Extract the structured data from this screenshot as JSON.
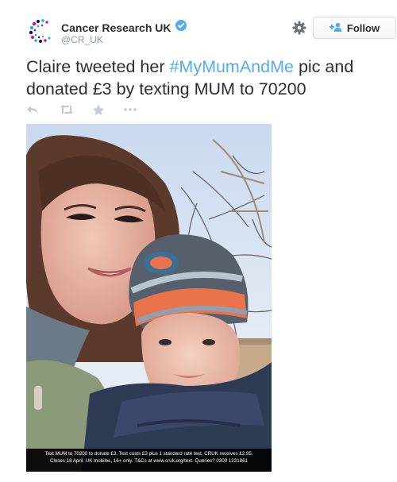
{
  "account": {
    "name": "Cancer Research UK",
    "handle": "@CR_UK",
    "verified": true,
    "brand_colors": [
      "#e6007e",
      "#2e008b",
      "#00b6ed"
    ]
  },
  "header": {
    "settings_icon": "gear-icon",
    "follow_label": "Follow",
    "follow_icon": "add-person-icon"
  },
  "tweet": {
    "text_before": "Claire tweeted her ",
    "hashtag": "#MyMumAndMe",
    "text_after": " pic and donated £3 by texting MUM to 70200",
    "hashtag_color": "#55acee"
  },
  "actions": [
    {
      "icon": "reply-icon"
    },
    {
      "icon": "retweet-icon"
    },
    {
      "icon": "favorite-star-icon"
    },
    {
      "icon": "more-dots-icon"
    }
  ],
  "photo": {
    "caption_line1": "Text MUM to 70200 to donate £3. Text costs £3 plus 1 standard rate text. CRUK receives £2.95.",
    "caption_line2": "Closes 18 April. UK mobiles, 16+ only. T&Cs at www.cruk.org/text. Queries? 0300 1231861"
  }
}
